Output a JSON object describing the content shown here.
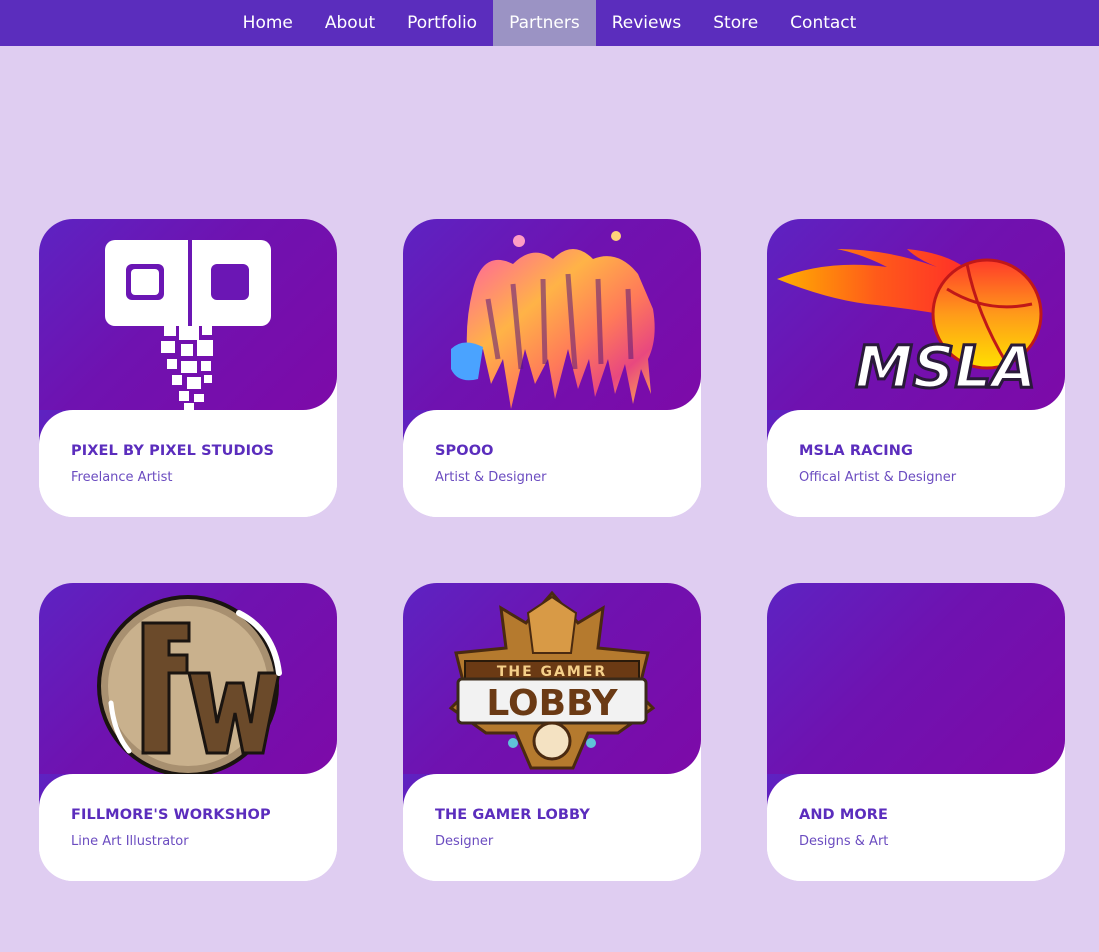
{
  "nav": {
    "items": [
      "Home",
      "About",
      "Portfolio",
      "Partners",
      "Reviews",
      "Store",
      "Contact"
    ],
    "active": "Partners"
  },
  "colors": {
    "nav_bg": "#5b2dbd",
    "nav_active": "#9b93c4",
    "page_bg": "#dfcdf1",
    "card_gradient_start": "#5d23c2",
    "card_gradient_end": "#7d0aa8",
    "title": "#5b2dbd"
  },
  "partners": [
    {
      "title": "PIXEL BY PIXEL STUDIOS",
      "subtitle": "Freelance Artist",
      "logo": "pixel-by-pixel-logo"
    },
    {
      "title": "SPOOO",
      "subtitle": "Artist & Designer",
      "logo": "spooo-drip-logo"
    },
    {
      "title": "MSLA RACING",
      "subtitle": "Offical Artist & Designer",
      "logo": "msla-racing-logo"
    },
    {
      "title": "FILLMORE'S WORKSHOP",
      "subtitle": "Line Art Illustrator",
      "logo": "fillmores-workshop-logo"
    },
    {
      "title": "THE GAMER LOBBY",
      "subtitle": "Designer",
      "logo": "gamer-lobby-logo",
      "logo_text": [
        "THE GAMER",
        "LOBBY"
      ]
    },
    {
      "title": "AND MORE",
      "subtitle": "Designs & Art",
      "logo": ""
    }
  ]
}
